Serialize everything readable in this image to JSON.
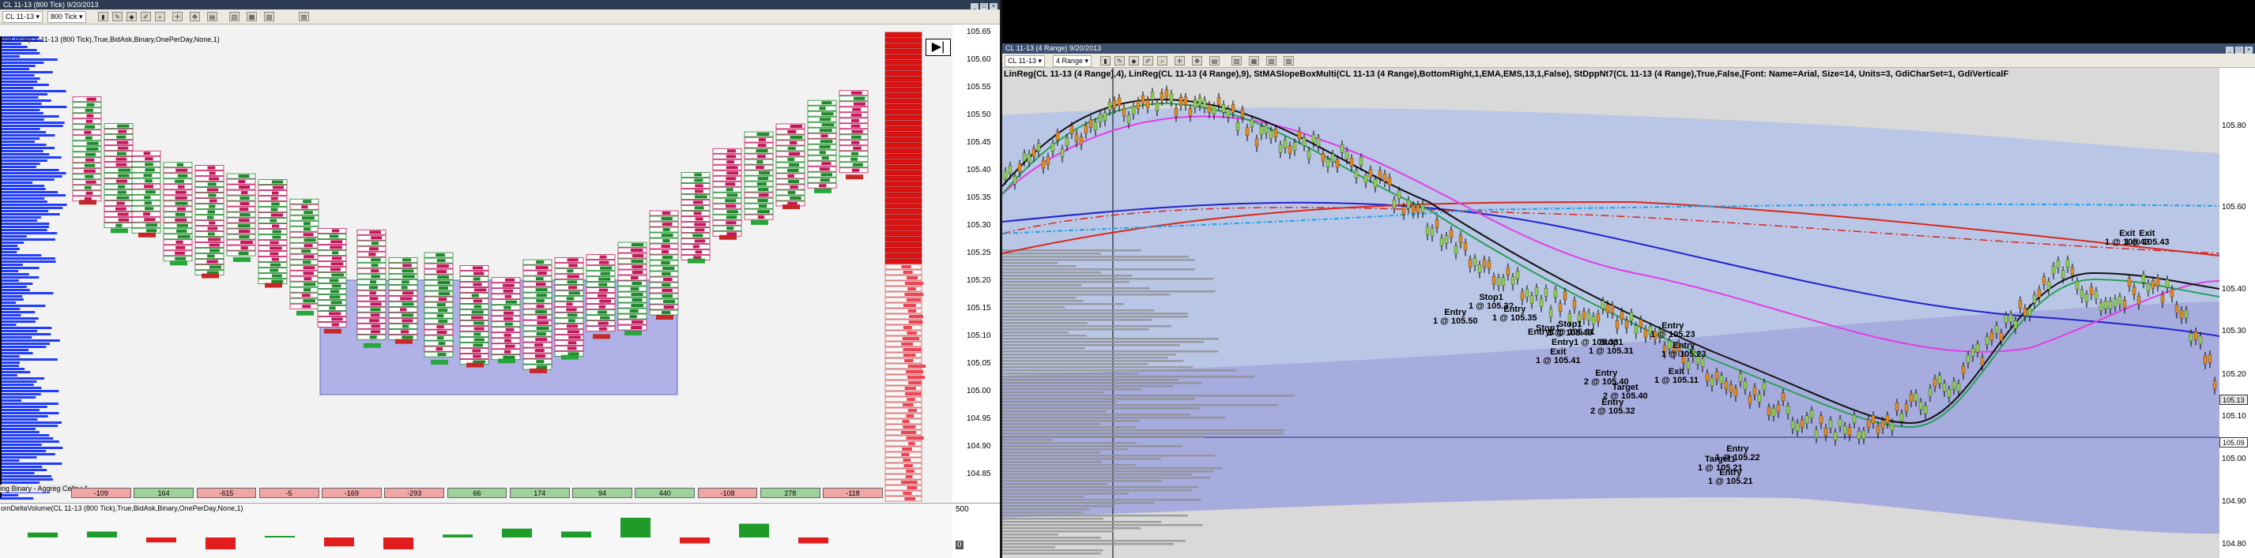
{
  "left_window": {
    "title": "CL 11-13 (800 Tick)  9/20/2013",
    "toolbar": {
      "instrument": "CL 11-13",
      "interval": "800 Tick"
    },
    "indicator_label": "ValLocal(CL 11-13 (800 Tick),True,BidAsk,Binary,OnePerDay,None,1)",
    "bottom_label": "ing Binary - Aggreg Cells : 1",
    "lower_panel_label": "omDeltaVolume(CL 11-13 (800 Tick),True,BidAsk,Binary,OnePerDay,None,1)",
    "price_axis": [
      "105.65",
      "105.60",
      "105.55",
      "105.50",
      "105.45",
      "105.40",
      "105.35",
      "105.30",
      "105.25",
      "105.20",
      "105.15",
      "105.10",
      "105.05",
      "105.00",
      "104.95",
      "104.90",
      "104.85"
    ],
    "lower_axis": [
      "500",
      "0"
    ],
    "delta_row": [
      "-109",
      "164",
      "-615",
      "-5",
      "-169",
      "-293",
      "66",
      "174",
      "94",
      "440",
      "-108",
      "278",
      "-118"
    ],
    "delta_volume": [
      0.25,
      0.3,
      -0.25,
      -0.6,
      0.05,
      -0.45,
      -0.6,
      0.15,
      0.45,
      0.3,
      1.0,
      -0.3,
      0.7,
      -0.3
    ]
  },
  "right_window": {
    "title": "CL 11-13 (4 Range)  9/20/2013",
    "toolbar": {
      "instrument": "CL 11-13",
      "interval": "4 Range"
    },
    "indicator_label": "LinReg(CL 11-13 (4 Range),4), LinReg(CL 11-13 (4 Range),9), StMASlopeBoxMulti(CL 11-13 (4 Range),BottomRight,1,EMA,EMS,13,1,False), StDppNt7(CL 11-13 (4 Range),True,False,[Font: Name=Arial, Size=14, Units=3, GdiCharSet=1, GdiVerticalF",
    "price_axis": [
      "105.80",
      "105.60",
      "105.40",
      "105.30",
      "105.20",
      "105.10",
      "105.00",
      "104.90",
      "104.80"
    ],
    "last_price_flags": [
      "105.13",
      "105.09"
    ],
    "annotations": [
      {
        "l1": "Entry",
        "l2": "1 @ 105.50"
      },
      {
        "l1": "Stop1",
        "l2": "1 @ 105.3?"
      },
      {
        "l1": "Entry",
        "l2": "1 @ 105.35"
      },
      {
        "l1": "Exit",
        "l2": "1 @ 105.41"
      },
      {
        "l1": "Stop1",
        "l2": "1 @ 105.49"
      },
      {
        "l1": "Stop1",
        "l2": ""
      },
      {
        "l1": "Entry1 @ 105.31",
        "l2": ""
      },
      {
        "l1": "Entry1 @ 105.33",
        "l2": ""
      },
      {
        "l1": "Stop1",
        "l2": "1 @ 105.31"
      },
      {
        "l1": "Entry",
        "l2": "2 @ 105.40"
      },
      {
        "l1": "Target",
        "l2": "2 @ 105.40"
      },
      {
        "l1": "Entry",
        "l2": "2 @ 105.32"
      },
      {
        "l1": "Entry",
        "l2": "1 @ 105.23"
      },
      {
        "l1": "Entry",
        "l2": "1 @ 105.23"
      },
      {
        "l1": "Exit",
        "l2": "1 @ 105.11"
      },
      {
        "l1": "Entry",
        "l2": "1 @ 105.21"
      },
      {
        "l1": "Entry",
        "l2": "1 @ 105.22"
      },
      {
        "l1": "Target1",
        "l2": "1 @ 105.21"
      },
      {
        "l1": "Exit",
        "l2": "1 @ 105.43"
      },
      {
        "l1": "Exit",
        "l2": "1 @ 105.43"
      }
    ]
  },
  "colors": {
    "bid_blue": "#1f3cff",
    "delta_red": "#e11d1d",
    "delta_green": "#1f9b2a",
    "band_fill": "#b9c6e6",
    "band_fill_dark": "#a6acdd",
    "ma_magenta": "#e23ee6",
    "ma_blue": "#2222cc",
    "ma_red": "#d8281c",
    "ma_green": "#2aa05a",
    "ma_black": "#111111",
    "dash_cyan": "#1fa3e6"
  }
}
